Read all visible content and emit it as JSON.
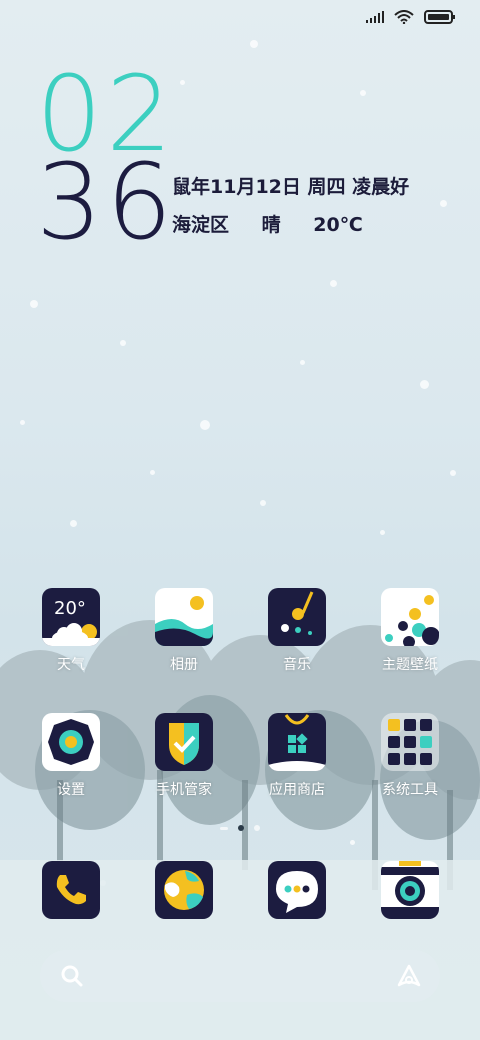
{
  "status_bar": {
    "icons": [
      "signal-icon",
      "wifi-icon",
      "battery-icon"
    ]
  },
  "clock": {
    "hour": "02",
    "minute": "36",
    "date_text": "鼠年11月12日 周四 凌晨好",
    "location": "海淀区",
    "condition": "晴",
    "temperature": "20℃"
  },
  "apps": [
    {
      "label": "天气",
      "icon_text": "20°"
    },
    {
      "label": "相册"
    },
    {
      "label": "音乐"
    },
    {
      "label": "主题壁纸"
    },
    {
      "label": "设置"
    },
    {
      "label": "手机管家"
    },
    {
      "label": "应用商店"
    },
    {
      "label": "系统工具"
    }
  ],
  "page_indicator": {
    "pages": 3,
    "active": 1
  },
  "dock": [
    {
      "name": "phone-icon"
    },
    {
      "name": "browser-icon"
    },
    {
      "name": "messages-icon"
    },
    {
      "name": "camera-icon"
    }
  ],
  "colors": {
    "accent_teal": "#3ccfc0",
    "icon_navy": "#1c1c40",
    "yellow": "#f4c020"
  }
}
